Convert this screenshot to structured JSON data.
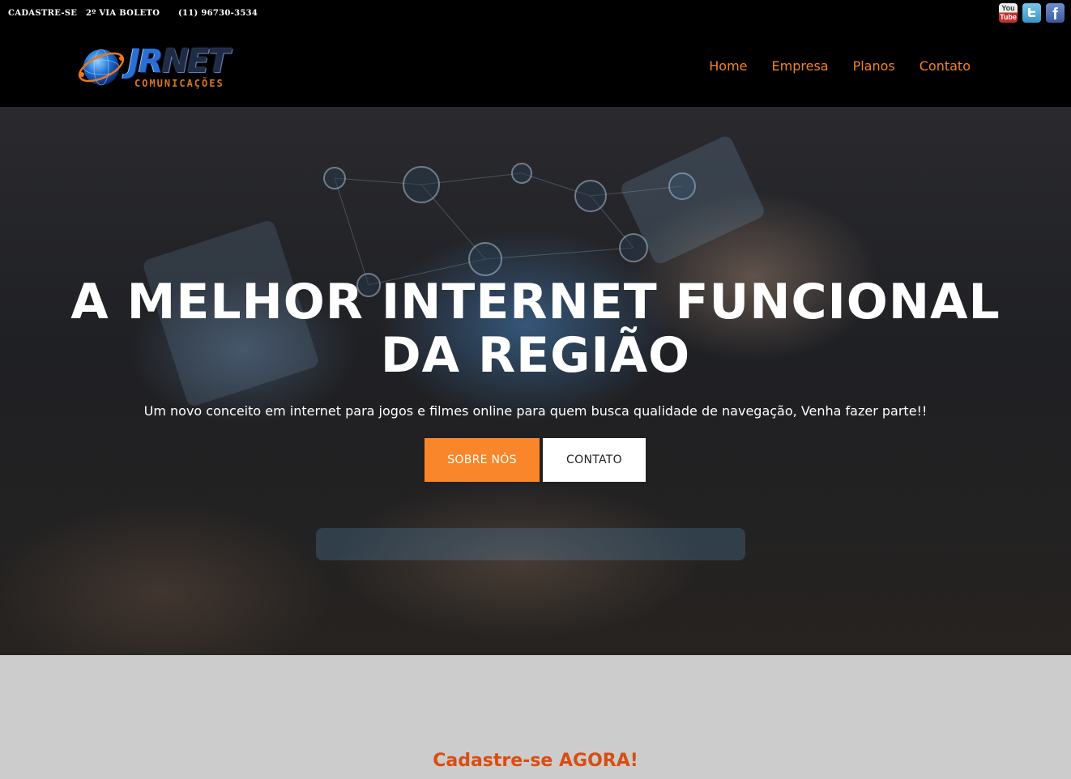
{
  "topbar": {
    "link_register": "CADASTRE-SE",
    "link_invoice": "2º VIA BOLETO",
    "phone": "(11) 96730-3534",
    "social": {
      "youtube_top": "You",
      "youtube_bottom": "Tube",
      "facebook": "f"
    }
  },
  "brand": {
    "name_part1": "JR",
    "name_part2": "NET",
    "tagline": "COMUNICAÇÕES"
  },
  "nav": {
    "items": [
      "Home",
      "Empresa",
      "Planos",
      "Contato"
    ]
  },
  "hero": {
    "title_line1": "A MELHOR INTERNET FUNCIONAL",
    "title_line2": "DA REGIÃO",
    "subtitle": "Um novo conceito em internet para jogos e filmes online para quem busca qualidade de navegação, Venha fazer parte!!",
    "button_about": "SOBRE NÓS",
    "button_contact": "CONTATO"
  },
  "signup": {
    "heading": "Cadastre-se AGORA!"
  },
  "colors": {
    "accent": "#f9862a",
    "nav": "#f28322",
    "heading": "#d94d12",
    "lower_bg": "#cccccc"
  }
}
